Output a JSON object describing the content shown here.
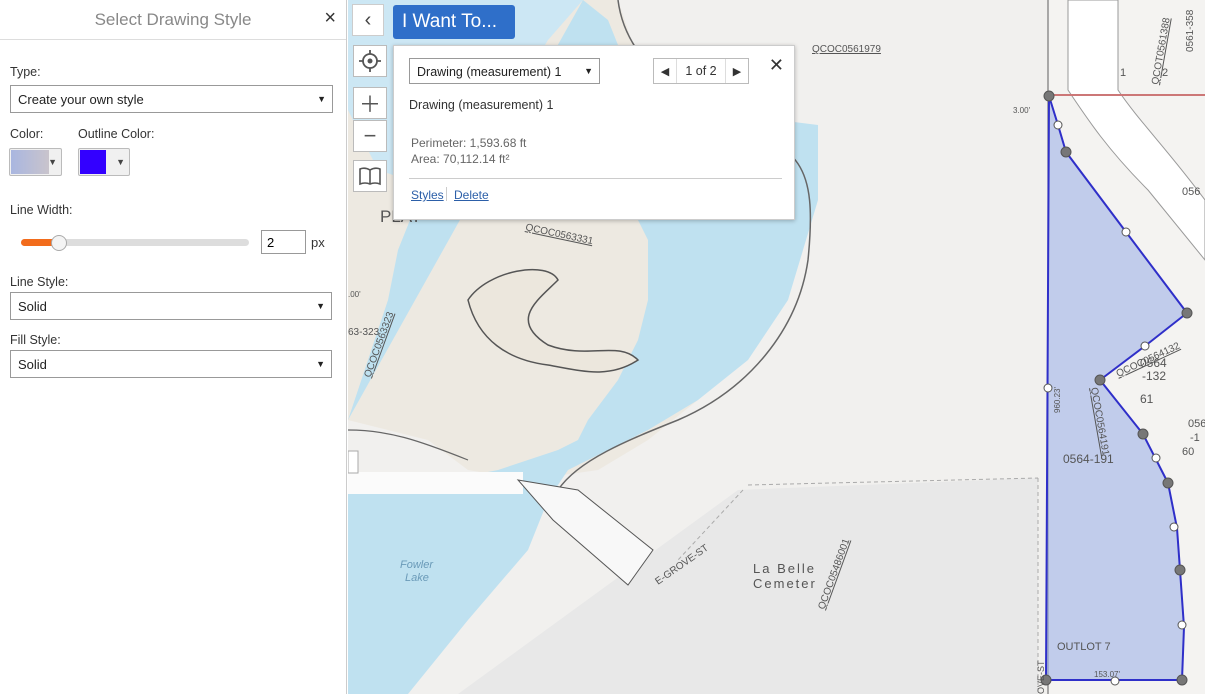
{
  "panel": {
    "title": "Select Drawing Style",
    "close_icon": "×",
    "type_label": "Type:",
    "type_value": "Create your own style",
    "color_label": "Color:",
    "outline_color_label": "Outline Color:",
    "fill_color": "#a9b6e0",
    "outline_color": "#3300ff",
    "line_width_label": "Line Width:",
    "line_width_value": "2",
    "line_width_unit": "px",
    "line_style_label": "Line Style:",
    "line_style_value": "Solid",
    "fill_style_label": "Fill Style:",
    "fill_style_value": "Solid"
  },
  "toolbar": {
    "back_icon": "chevron-left-icon",
    "i_want_to": "I Want To..."
  },
  "popup": {
    "select_value": "Drawing (measurement) 1",
    "pager_text": "1 of 2",
    "name": "Drawing (measurement) 1",
    "perimeter": "Perimeter: 1,593.68 ft",
    "area": "Area: 70,112.14 ft²",
    "styles_link": "Styles",
    "delete_link": "Delete"
  },
  "map": {
    "labels": {
      "plat": "PLAT",
      "la_belle": "La Belle",
      "cemetery": "Cemeter",
      "fowler": "Fowler",
      "lake": "Lake",
      "grove_st": "E-GROVE-ST",
      "parcel1": "QCOC0561979",
      "parcel2": "QCOC0563331",
      "parcel3": "QCOC0563323",
      "parcel4": "QCOC05486001",
      "parcel5": "QCOC0564132",
      "parcel6": "QCOC0564191",
      "parcel7": "QCOT0561388",
      "p0564_191": "0564-191",
      "p0564": "0564",
      "p132": "-132",
      "p61": "61",
      "outlot": "OUTLOT 7",
      "n1": "1",
      "n2": "2",
      "n0561": "0561-358",
      "n63_323": "63-323",
      "n60": "60",
      "n056": "056",
      "n056b": "056",
      "n1b": "-1",
      "dim_300": "3.00'",
      "dim_00": ".00'",
      "dim_153": "153.07'",
      "dim_960": "960.23'",
      "ove_st": "OVE-ST"
    }
  }
}
